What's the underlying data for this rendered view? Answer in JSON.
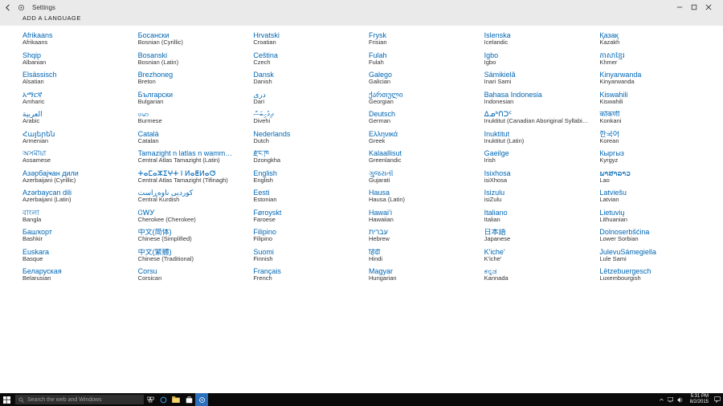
{
  "window": {
    "title": "Settings",
    "page_heading": "ADD A LANGUAGE"
  },
  "taskbar": {
    "search_placeholder": "Search the web and Windows",
    "time": "5:31 PM",
    "date": "8/2/2015"
  },
  "columns": [
    [
      {
        "native": "Afrikaans",
        "english": "Afrikaans"
      },
      {
        "native": "Shqip",
        "english": "Albanian"
      },
      {
        "native": "Elsässisch",
        "english": "Alsatian"
      },
      {
        "native": "አማርኛ",
        "english": "Amharic"
      },
      {
        "native": "العربية",
        "english": "Arabic"
      },
      {
        "native": "Հայերեն",
        "english": "Armenian"
      },
      {
        "native": "অসমীয়া",
        "english": "Assamese"
      },
      {
        "native": "Азәрбајҹан дили",
        "english": "Azerbaijani (Cyrillic)"
      },
      {
        "native": "Azərbaycan dili",
        "english": "Azerbaijani (Latin)"
      },
      {
        "native": "বাংলা",
        "english": "Bangla"
      },
      {
        "native": "Башҡорт",
        "english": "Bashkir"
      },
      {
        "native": "Euskara",
        "english": "Basque"
      },
      {
        "native": "Беларуская",
        "english": "Belarusian"
      }
    ],
    [
      {
        "native": "Босански",
        "english": "Bosnian (Cyrillic)"
      },
      {
        "native": "Bosanski",
        "english": "Bosnian (Latin)"
      },
      {
        "native": "Brezhoneg",
        "english": "Breton"
      },
      {
        "native": "Български",
        "english": "Bulgarian"
      },
      {
        "native": "ဗမာ",
        "english": "Burmese"
      },
      {
        "native": "Català",
        "english": "Catalan"
      },
      {
        "native": "Tamazight n latlas n wamm…",
        "english": "Central Atlas Tamazight (Latin)"
      },
      {
        "native": "ⵜⴰⵎⴰⵣⵉⵖⵜ ⵏ ⵍⴰⵟⵍⴰⵚ",
        "english": "Central Atlas Tamazight (Tifinagh)"
      },
      {
        "native": "کوردیی ناوەڕاست",
        "english": "Central Kurdish"
      },
      {
        "native": "ᏣᎳᎩ",
        "english": "Cherokee (Cherokee)"
      },
      {
        "native": "中文(简体)",
        "english": "Chinese (Simplified)"
      },
      {
        "native": "中文(繁體)",
        "english": "Chinese (Traditional)"
      },
      {
        "native": "Corsu",
        "english": "Corsican"
      }
    ],
    [
      {
        "native": "Hrvatski",
        "english": "Croatian"
      },
      {
        "native": "Čeština",
        "english": "Czech"
      },
      {
        "native": "Dansk",
        "english": "Danish"
      },
      {
        "native": "درى",
        "english": "Dari"
      },
      {
        "native": "ދިވެހިބަސް",
        "english": "Divehi"
      },
      {
        "native": "Nederlands",
        "english": "Dutch"
      },
      {
        "native": "རྫོང་ཁ",
        "english": "Dzongkha"
      },
      {
        "native": "English",
        "english": "English"
      },
      {
        "native": "Eesti",
        "english": "Estonian"
      },
      {
        "native": "Føroyskt",
        "english": "Faroese"
      },
      {
        "native": "Filipino",
        "english": "Filipino"
      },
      {
        "native": "Suomi",
        "english": "Finnish"
      },
      {
        "native": "Français",
        "english": "French"
      }
    ],
    [
      {
        "native": "Frysk",
        "english": "Frisian"
      },
      {
        "native": "Fulah",
        "english": "Fulah"
      },
      {
        "native": "Galego",
        "english": "Galician"
      },
      {
        "native": "ქართული",
        "english": "Georgian"
      },
      {
        "native": "Deutsch",
        "english": "German"
      },
      {
        "native": "Ελληνικά",
        "english": "Greek"
      },
      {
        "native": "Kalaallisut",
        "english": "Greenlandic"
      },
      {
        "native": "ગુજરાતી",
        "english": "Gujarati"
      },
      {
        "native": "Hausa",
        "english": "Hausa (Latin)"
      },
      {
        "native": "Hawaiʻi",
        "english": "Hawaiian"
      },
      {
        "native": "עברית",
        "english": "Hebrew"
      },
      {
        "native": "हिंदी",
        "english": "Hindi"
      },
      {
        "native": "Magyar",
        "english": "Hungarian"
      }
    ],
    [
      {
        "native": "Íslenska",
        "english": "Icelandic"
      },
      {
        "native": "Igbo",
        "english": "Igbo"
      },
      {
        "native": "Sämikielâ",
        "english": "Inari Sami"
      },
      {
        "native": "Bahasa Indonesia",
        "english": "Indonesian"
      },
      {
        "native": "ᐃᓄᒃᑎᑐᑦ",
        "english": "Inuktitut (Canadian Aboriginal Syllabics)"
      },
      {
        "native": "Inuktitut",
        "english": "Inuktitut (Latin)"
      },
      {
        "native": "Gaeilge",
        "english": "Irish"
      },
      {
        "native": "Isixhosa",
        "english": "isiXhosa"
      },
      {
        "native": "Isizulu",
        "english": "isiZulu"
      },
      {
        "native": "Italiano",
        "english": "Italian"
      },
      {
        "native": "日本語",
        "english": "Japanese"
      },
      {
        "native": "K'iche'",
        "english": "K'iche'"
      },
      {
        "native": "ಕನ್ನಡ",
        "english": "Kannada"
      }
    ],
    [
      {
        "native": "Қазақ",
        "english": "Kazakh"
      },
      {
        "native": "ភាសាខ្មែរ",
        "english": "Khmer"
      },
      {
        "native": "Kinyarwanda",
        "english": "Kinyarwanda"
      },
      {
        "native": "Kiswahili",
        "english": "Kiswahili"
      },
      {
        "native": "कोंकणी",
        "english": "Konkani"
      },
      {
        "native": "한국어",
        "english": "Korean"
      },
      {
        "native": "Кыргыз",
        "english": "Kyrgyz"
      },
      {
        "native": "ພາສາລາວ",
        "english": "Lao"
      },
      {
        "native": "Latviešu",
        "english": "Latvian"
      },
      {
        "native": "Lietuvių",
        "english": "Lithuanian"
      },
      {
        "native": "Dolnoserbšćina",
        "english": "Lower Sorbian"
      },
      {
        "native": "JulevuSámegiella",
        "english": "Lule Sami"
      },
      {
        "native": "Lëtzebuergesch",
        "english": "Luxembourgish"
      }
    ]
  ]
}
